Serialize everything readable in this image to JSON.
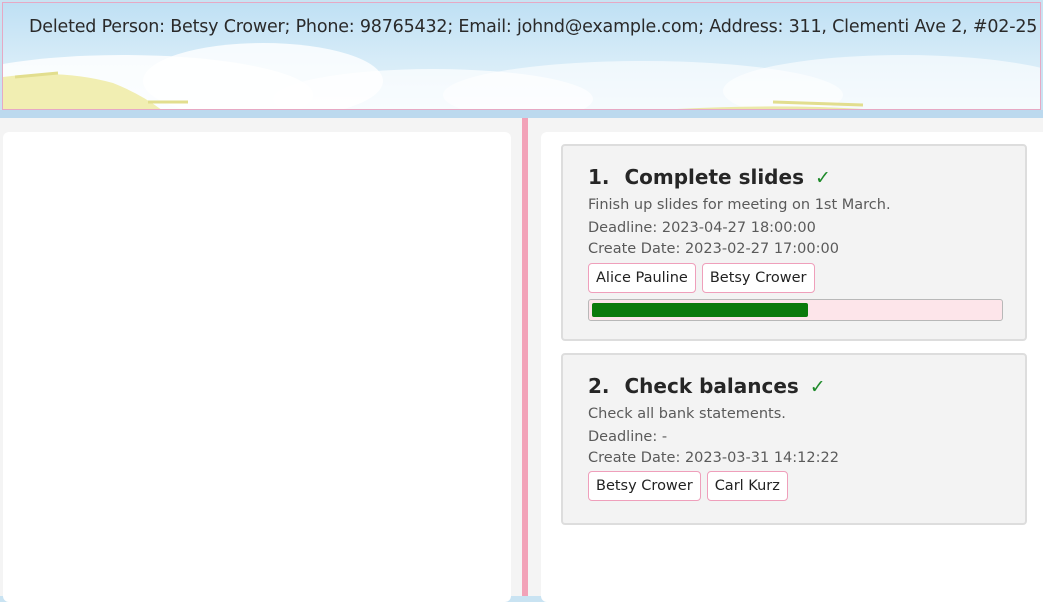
{
  "result": {
    "message": "Deleted Person: Betsy Crower; Phone: 98765432; Email: johnd@example.com; Address: 311, Clementi Ave 2, #02-25"
  },
  "tasks": [
    {
      "index": "1.",
      "title": "Complete slides",
      "done_mark": "✓",
      "description": "Finish up slides for meeting on 1st March.",
      "deadline": "Deadline: 2023-04-27 18:00:00",
      "create_date": "Create Date: 2023-02-27 17:00:00",
      "tags": [
        "Alice Pauline",
        "Betsy Crower"
      ],
      "progress": 0.53
    },
    {
      "index": "2.",
      "title": "Check balances",
      "done_mark": "✓",
      "description": "Check all bank statements.",
      "deadline": "Deadline: -",
      "create_date": "Create Date: 2023-03-31 14:12:22",
      "tags": [
        "Betsy Crower",
        "Carl Kurz"
      ]
    }
  ],
  "colors": {
    "accent_pink": "#f2a2b8",
    "progress_fill": "#0c7a0c",
    "check_green": "#1e8a2a"
  },
  "icons": {
    "done": "check-mark-icon"
  }
}
